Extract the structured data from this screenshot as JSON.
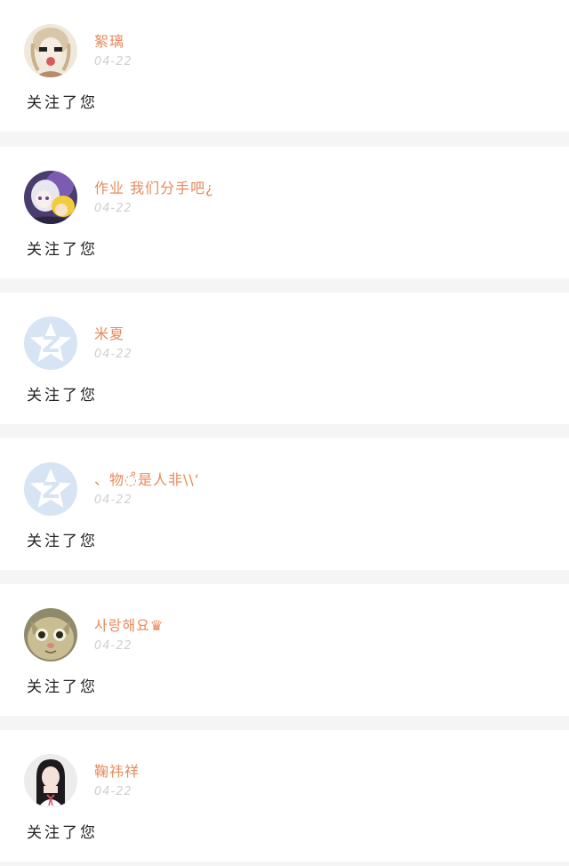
{
  "notifications": [
    {
      "username": "絮璃",
      "date": "04-22",
      "action": "关注了您",
      "avatar_icon": "anime-girl-avatar"
    },
    {
      "username": "作业 我们分手吧¿",
      "date": "04-22",
      "action": "关注了您",
      "avatar_icon": "anime-characters-avatar"
    },
    {
      "username": "米夏",
      "date": "04-22",
      "action": "关注了您",
      "avatar_icon": "default-qzone-star-avatar"
    },
    {
      "username": "、物◌̊是人非\\\\‘",
      "date": "04-22",
      "action": "关注了您",
      "avatar_icon": "default-qzone-star-avatar"
    },
    {
      "username": "사랑해요♛",
      "date": "04-22",
      "action": "关注了您",
      "avatar_icon": "cat-face-avatar"
    },
    {
      "username": "鞠祎祥",
      "date": "04-22",
      "action": "关注了您",
      "avatar_icon": "girl-photo-avatar"
    }
  ],
  "colors": {
    "username": "#e8895a",
    "date": "#cfcfcf",
    "action": "#222222",
    "card_bg": "#ffffff",
    "separator": "#f5f5f5"
  }
}
